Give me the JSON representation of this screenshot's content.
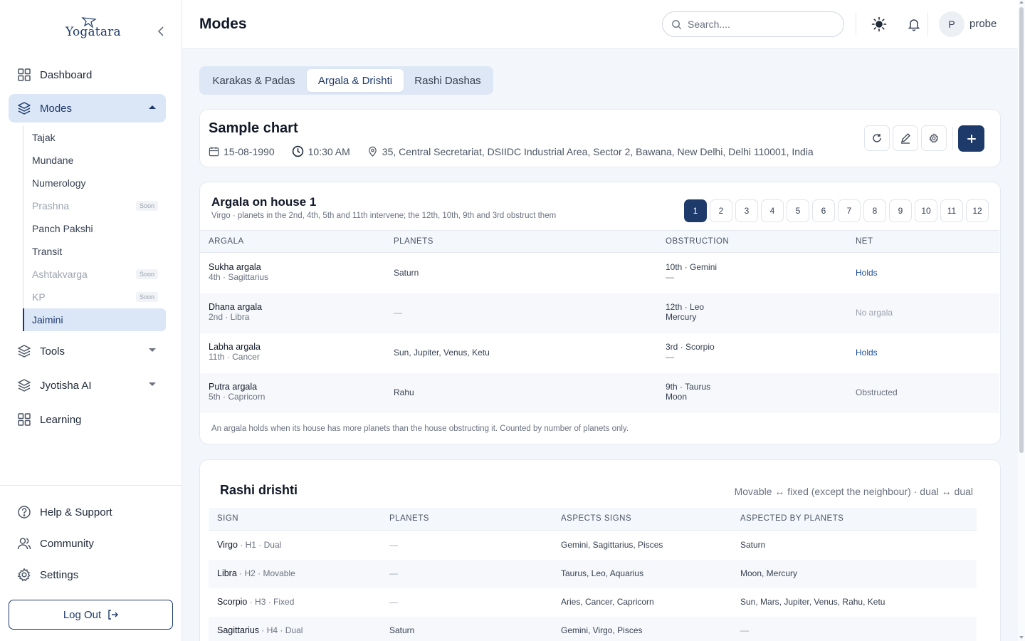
{
  "sidebar": {
    "logo_text": "Yogatara",
    "items": [
      {
        "label": "Dashboard"
      },
      {
        "label": "Modes"
      },
      {
        "label": "Tools"
      },
      {
        "label": "Jyotisha AI"
      },
      {
        "label": "Learning"
      }
    ],
    "modes_sub": [
      {
        "label": "Tajak"
      },
      {
        "label": "Mundane"
      },
      {
        "label": "Numerology"
      },
      {
        "label": "Prashna",
        "badge": "Soon"
      },
      {
        "label": "Panch Pakshi"
      },
      {
        "label": "Transit"
      },
      {
        "label": "Ashtakvarga",
        "badge": "Soon"
      },
      {
        "label": "KP",
        "badge": "Soon"
      },
      {
        "label": "Jaimini"
      }
    ],
    "footer": [
      {
        "label": "Help & Support"
      },
      {
        "label": "Community"
      },
      {
        "label": "Settings"
      }
    ],
    "logout": "Log Out"
  },
  "header": {
    "title": "Modes",
    "search_placeholder": "Search....",
    "avatar_initial": "P",
    "user_name": "probe"
  },
  "tabs": [
    {
      "label": "Karakas & Padas"
    },
    {
      "label": "Argala & Drishti"
    },
    {
      "label": "Rashi Dashas"
    }
  ],
  "chart": {
    "title": "Sample chart",
    "date": "15-08-1990",
    "time": "10:30 AM",
    "location": "35, Central Secretariat, DSIIDC Industrial Area, Sector 2, Bawana, New Delhi, Delhi 110001, India"
  },
  "argala": {
    "title": "Argala on house 1",
    "subtitle": "Virgo · planets in the 2nd, 4th, 5th and 11th intervene; the 12th, 10th, 9th and 3rd obstruct them",
    "houses": [
      "1",
      "2",
      "3",
      "4",
      "5",
      "6",
      "7",
      "8",
      "9",
      "10",
      "11",
      "12"
    ],
    "selected_house": "1",
    "columns": [
      "Argala",
      "Planets",
      "Obstruction",
      "Net"
    ],
    "rows": [
      {
        "name": "Sukha argala",
        "house": "4th · Sagittarius",
        "planets": "Saturn",
        "obs_house": "10th · Gemini",
        "obs_planets": "—",
        "net": "Holds"
      },
      {
        "name": "Dhana argala",
        "house": "2nd · Libra",
        "planets": "—",
        "obs_house": "12th · Leo",
        "obs_planets": "Mercury",
        "net": "No argala"
      },
      {
        "name": "Labha argala",
        "house": "11th · Cancer",
        "planets": "Sun, Jupiter, Venus, Ketu",
        "obs_house": "3rd · Scorpio",
        "obs_planets": "—",
        "net": "Holds"
      },
      {
        "name": "Putra argala",
        "house": "5th · Capricorn",
        "planets": "Rahu",
        "obs_house": "9th · Taurus",
        "obs_planets": "Moon",
        "net": "Obstructed"
      }
    ],
    "note": "An argala holds when its house has more planets than the house obstructing it. Counted by number of planets only."
  },
  "drishti": {
    "title": "Rashi drishti",
    "rule": "Movable ↔ fixed (except the neighbour) · dual ↔ dual",
    "columns": [
      "Sign",
      "Planets",
      "Aspects signs",
      "Aspected by planets"
    ],
    "rows": [
      {
        "sign": "Virgo",
        "meta": " · H1 · Dual",
        "planets": "—",
        "aspects": "Gemini, Sagittarius, Pisces",
        "aspected_by": "Saturn"
      },
      {
        "sign": "Libra",
        "meta": " · H2 · Movable",
        "planets": "—",
        "aspects": "Taurus, Leo, Aquarius",
        "aspected_by": "Moon, Mercury"
      },
      {
        "sign": "Scorpio",
        "meta": " · H3 · Fixed",
        "planets": "—",
        "aspects": "Aries, Cancer, Capricorn",
        "aspected_by": "Sun, Mars, Jupiter, Venus, Rahu, Ketu"
      },
      {
        "sign": "Sagittarius",
        "meta": " · H4 · Dual",
        "planets": "Saturn",
        "aspects": "Gemini, Virgo, Pisces",
        "aspected_by": "—"
      }
    ]
  },
  "colors": {
    "primary": "#1e3a6b",
    "active_bg": "#dbe6f7",
    "page_bg": "#f3f6fb"
  }
}
